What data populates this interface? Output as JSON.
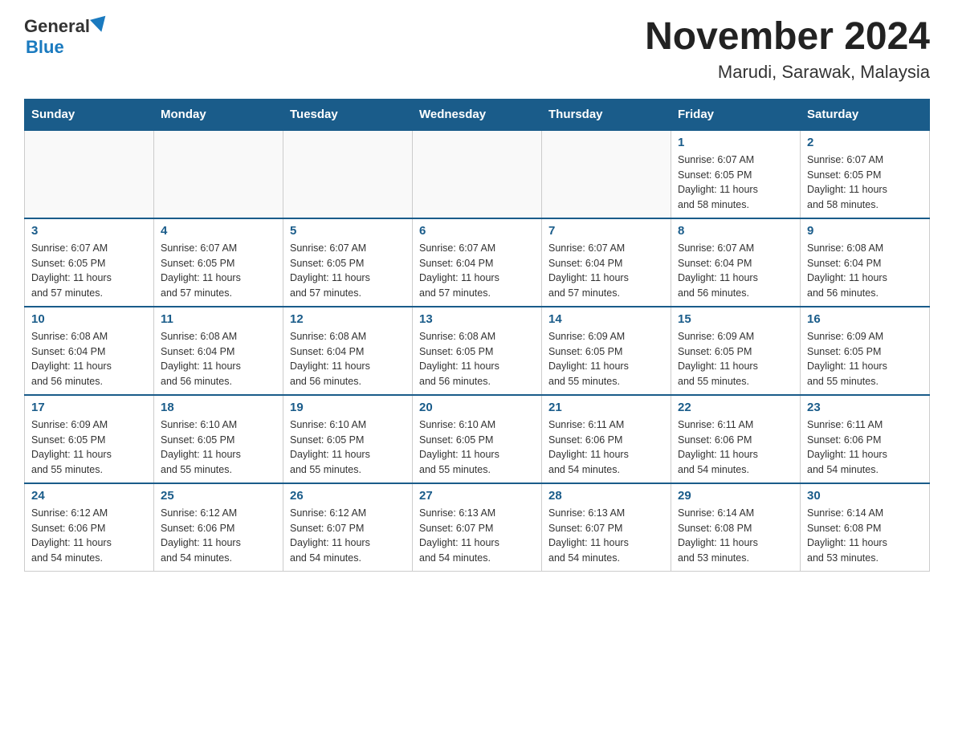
{
  "header": {
    "logo_general": "General",
    "logo_blue": "Blue",
    "month_title": "November 2024",
    "location": "Marudi, Sarawak, Malaysia"
  },
  "weekdays": [
    "Sunday",
    "Monday",
    "Tuesday",
    "Wednesday",
    "Thursday",
    "Friday",
    "Saturday"
  ],
  "weeks": [
    [
      {
        "day": "",
        "info": ""
      },
      {
        "day": "",
        "info": ""
      },
      {
        "day": "",
        "info": ""
      },
      {
        "day": "",
        "info": ""
      },
      {
        "day": "",
        "info": ""
      },
      {
        "day": "1",
        "info": "Sunrise: 6:07 AM\nSunset: 6:05 PM\nDaylight: 11 hours\nand 58 minutes."
      },
      {
        "day": "2",
        "info": "Sunrise: 6:07 AM\nSunset: 6:05 PM\nDaylight: 11 hours\nand 58 minutes."
      }
    ],
    [
      {
        "day": "3",
        "info": "Sunrise: 6:07 AM\nSunset: 6:05 PM\nDaylight: 11 hours\nand 57 minutes."
      },
      {
        "day": "4",
        "info": "Sunrise: 6:07 AM\nSunset: 6:05 PM\nDaylight: 11 hours\nand 57 minutes."
      },
      {
        "day": "5",
        "info": "Sunrise: 6:07 AM\nSunset: 6:05 PM\nDaylight: 11 hours\nand 57 minutes."
      },
      {
        "day": "6",
        "info": "Sunrise: 6:07 AM\nSunset: 6:04 PM\nDaylight: 11 hours\nand 57 minutes."
      },
      {
        "day": "7",
        "info": "Sunrise: 6:07 AM\nSunset: 6:04 PM\nDaylight: 11 hours\nand 57 minutes."
      },
      {
        "day": "8",
        "info": "Sunrise: 6:07 AM\nSunset: 6:04 PM\nDaylight: 11 hours\nand 56 minutes."
      },
      {
        "day": "9",
        "info": "Sunrise: 6:08 AM\nSunset: 6:04 PM\nDaylight: 11 hours\nand 56 minutes."
      }
    ],
    [
      {
        "day": "10",
        "info": "Sunrise: 6:08 AM\nSunset: 6:04 PM\nDaylight: 11 hours\nand 56 minutes."
      },
      {
        "day": "11",
        "info": "Sunrise: 6:08 AM\nSunset: 6:04 PM\nDaylight: 11 hours\nand 56 minutes."
      },
      {
        "day": "12",
        "info": "Sunrise: 6:08 AM\nSunset: 6:04 PM\nDaylight: 11 hours\nand 56 minutes."
      },
      {
        "day": "13",
        "info": "Sunrise: 6:08 AM\nSunset: 6:05 PM\nDaylight: 11 hours\nand 56 minutes."
      },
      {
        "day": "14",
        "info": "Sunrise: 6:09 AM\nSunset: 6:05 PM\nDaylight: 11 hours\nand 55 minutes."
      },
      {
        "day": "15",
        "info": "Sunrise: 6:09 AM\nSunset: 6:05 PM\nDaylight: 11 hours\nand 55 minutes."
      },
      {
        "day": "16",
        "info": "Sunrise: 6:09 AM\nSunset: 6:05 PM\nDaylight: 11 hours\nand 55 minutes."
      }
    ],
    [
      {
        "day": "17",
        "info": "Sunrise: 6:09 AM\nSunset: 6:05 PM\nDaylight: 11 hours\nand 55 minutes."
      },
      {
        "day": "18",
        "info": "Sunrise: 6:10 AM\nSunset: 6:05 PM\nDaylight: 11 hours\nand 55 minutes."
      },
      {
        "day": "19",
        "info": "Sunrise: 6:10 AM\nSunset: 6:05 PM\nDaylight: 11 hours\nand 55 minutes."
      },
      {
        "day": "20",
        "info": "Sunrise: 6:10 AM\nSunset: 6:05 PM\nDaylight: 11 hours\nand 55 minutes."
      },
      {
        "day": "21",
        "info": "Sunrise: 6:11 AM\nSunset: 6:06 PM\nDaylight: 11 hours\nand 54 minutes."
      },
      {
        "day": "22",
        "info": "Sunrise: 6:11 AM\nSunset: 6:06 PM\nDaylight: 11 hours\nand 54 minutes."
      },
      {
        "day": "23",
        "info": "Sunrise: 6:11 AM\nSunset: 6:06 PM\nDaylight: 11 hours\nand 54 minutes."
      }
    ],
    [
      {
        "day": "24",
        "info": "Sunrise: 6:12 AM\nSunset: 6:06 PM\nDaylight: 11 hours\nand 54 minutes."
      },
      {
        "day": "25",
        "info": "Sunrise: 6:12 AM\nSunset: 6:06 PM\nDaylight: 11 hours\nand 54 minutes."
      },
      {
        "day": "26",
        "info": "Sunrise: 6:12 AM\nSunset: 6:07 PM\nDaylight: 11 hours\nand 54 minutes."
      },
      {
        "day": "27",
        "info": "Sunrise: 6:13 AM\nSunset: 6:07 PM\nDaylight: 11 hours\nand 54 minutes."
      },
      {
        "day": "28",
        "info": "Sunrise: 6:13 AM\nSunset: 6:07 PM\nDaylight: 11 hours\nand 54 minutes."
      },
      {
        "day": "29",
        "info": "Sunrise: 6:14 AM\nSunset: 6:08 PM\nDaylight: 11 hours\nand 53 minutes."
      },
      {
        "day": "30",
        "info": "Sunrise: 6:14 AM\nSunset: 6:08 PM\nDaylight: 11 hours\nand 53 minutes."
      }
    ]
  ]
}
